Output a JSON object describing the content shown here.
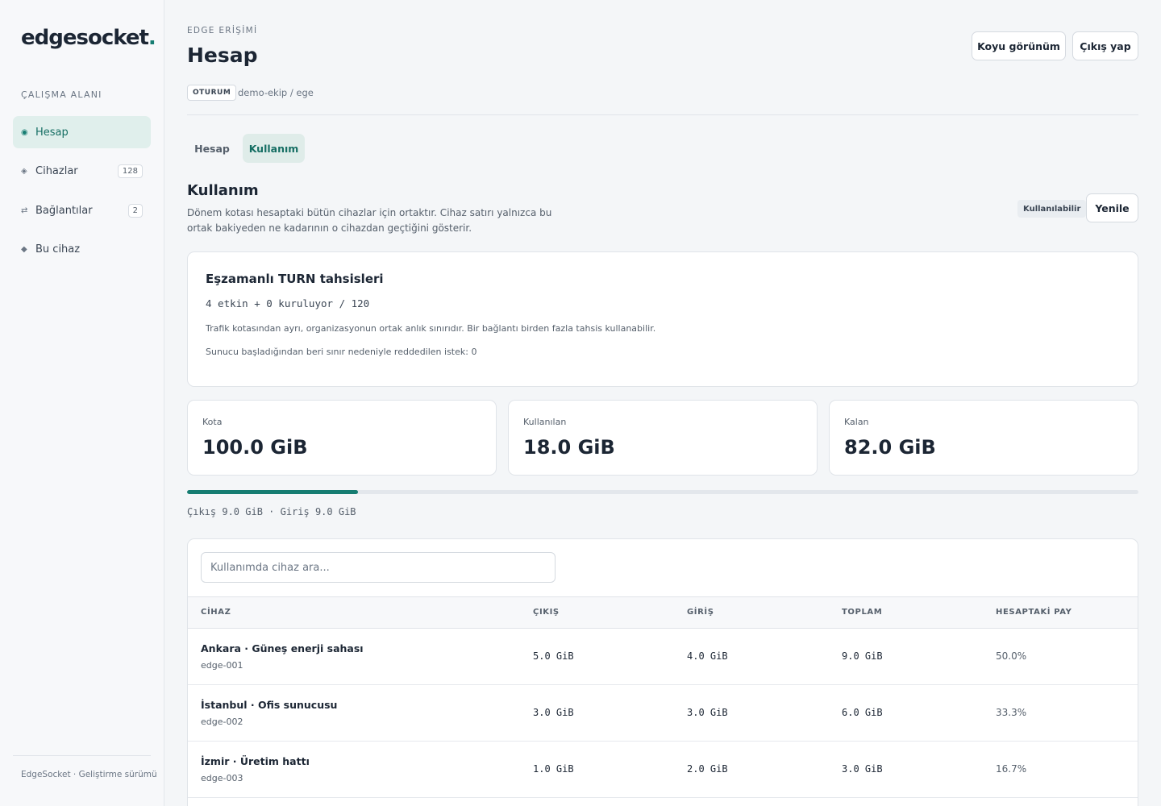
{
  "sidebar": {
    "logo_text": "edgesocket",
    "logo_dot": ".",
    "heading": "ÇALIŞMA ALANI",
    "items": [
      {
        "label": "Hesap",
        "icon": "target-icon",
        "glyph": "◉",
        "badge": ""
      },
      {
        "label": "Cihazlar",
        "icon": "diamond-outline-icon",
        "glyph": "◈",
        "badge": "128"
      },
      {
        "label": "Bağlantılar",
        "icon": "swap-arrows-icon",
        "glyph": "⇄",
        "badge": "2"
      },
      {
        "label": "Bu cihaz",
        "icon": "diamond-icon",
        "glyph": "◆",
        "badge": ""
      }
    ],
    "footer": "EdgeSocket · Geliştirme sürümü"
  },
  "header": {
    "eyebrow": "EDGE ERİŞİMİ",
    "title": "Hesap",
    "dark_mode_label": "Koyu görünüm",
    "logout_label": "Çıkış yap",
    "session_tag": "OTURUM",
    "session_path": "demo-ekip / ege"
  },
  "tabs": [
    {
      "label": "Hesap",
      "active": false
    },
    {
      "label": "Kullanım",
      "active": true
    }
  ],
  "usage": {
    "title": "Kullanım",
    "description": "Dönem kotası hesaptaki bütün cihazlar için ortaktır. Cihaz satırı yalnızca bu ortak bakiyeden ne kadarının o cihazdan geçtiğini gösterir.",
    "status": "Kullanılabilir",
    "refresh_label": "Yenile"
  },
  "turn": {
    "title": "Eşzamanlı TURN tahsisleri",
    "summary": "4 etkin + 0 kuruluyor / 120",
    "note": "Trafik kotasından ayrı, organizasyonun ortak anlık sınırıdır. Bir bağlantı birden fazla tahsis kullanabilir.",
    "rejected": "Sunucu başladığından beri sınır nedeniyle reddedilen istek: 0"
  },
  "stats": [
    {
      "label": "Kota",
      "value": "100.0 GiB"
    },
    {
      "label": "Kullanılan",
      "value": "18.0 GiB"
    },
    {
      "label": "Kalan",
      "value": "82.0 GiB"
    }
  ],
  "quota_used_fraction": 0.18,
  "traffic": "Çıkış 9.0 GiB · Giriş 9.0 GiB",
  "table": {
    "search_placeholder": "Kullanımda cihaz ara...",
    "columns": [
      "CİHAZ",
      "ÇIKIŞ",
      "GİRİŞ",
      "TOPLAM",
      "HESAPTAKİ PAY"
    ],
    "rows": [
      {
        "name": "Ankara · Güneş enerji sahası",
        "id": "edge-001",
        "out": "5.0 GiB",
        "in": "4.0 GiB",
        "total": "9.0 GiB",
        "share": "50.0%"
      },
      {
        "name": "İstanbul · Ofis sunucusu",
        "id": "edge-002",
        "out": "3.0 GiB",
        "in": "3.0 GiB",
        "total": "6.0 GiB",
        "share": "33.3%"
      },
      {
        "name": "İzmir · Üretim hattı",
        "id": "edge-003",
        "out": "1.0 GiB",
        "in": "2.0 GiB",
        "total": "3.0 GiB",
        "share": "16.7%"
      }
    ]
  },
  "colors": {
    "accent": "#167d72",
    "accent_soft": "#e0efec"
  }
}
